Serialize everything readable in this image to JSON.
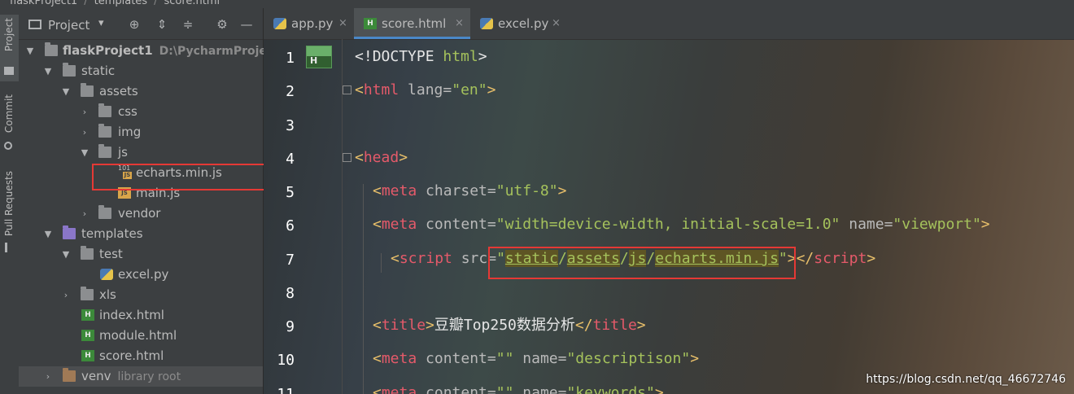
{
  "breadcrumb": {
    "items": [
      "flaskProject1",
      "templates",
      "score.html"
    ]
  },
  "tool_strip": {
    "tabs": [
      "Project",
      "Commit",
      "Pull Requests"
    ]
  },
  "project_panel": {
    "title": "Project",
    "dropdown_icon": "caret-down-icon",
    "header_icons": [
      "locate-icon",
      "expand-all-icon",
      "collapse-all-icon",
      "gear-icon",
      "minimize-icon"
    ],
    "tree": [
      {
        "label": "flaskProject1",
        "hint": "D:\\PycharmProjects",
        "icon": "folder-icon",
        "expanded": true,
        "bold": true
      },
      {
        "label": "static",
        "icon": "folder-icon",
        "expanded": true
      },
      {
        "label": "assets",
        "icon": "folder-icon",
        "expanded": true
      },
      {
        "label": "css",
        "icon": "folder-icon",
        "expanded": false
      },
      {
        "label": "img",
        "icon": "folder-icon",
        "expanded": false
      },
      {
        "label": "js",
        "icon": "folder-icon",
        "expanded": true
      },
      {
        "label": "echarts.min.js",
        "icon": "minified-js-file-icon"
      },
      {
        "label": "main.js",
        "icon": "js-file-icon"
      },
      {
        "label": "vendor",
        "icon": "folder-icon",
        "expanded": false
      },
      {
        "label": "templates",
        "icon": "templates-folder-icon",
        "expanded": true
      },
      {
        "label": "test",
        "icon": "folder-icon",
        "expanded": true
      },
      {
        "label": "excel.py",
        "icon": "python-file-icon"
      },
      {
        "label": "xls",
        "icon": "folder-icon",
        "expanded": false
      },
      {
        "label": "index.html",
        "icon": "html-file-icon"
      },
      {
        "label": "module.html",
        "icon": "html-file-icon"
      },
      {
        "label": "score.html",
        "icon": "html-file-icon"
      },
      {
        "label": "venv",
        "hint": "library root",
        "icon": "excluded-folder-icon",
        "expanded": false
      }
    ]
  },
  "editor": {
    "tabs": [
      {
        "label": "app.py",
        "icon": "python-file-icon",
        "close": "×"
      },
      {
        "label": "score.html",
        "icon": "html-file-icon",
        "close": "×",
        "active": true
      },
      {
        "label": "excel.py",
        "icon": "python-file-icon",
        "close": "×"
      }
    ],
    "file_badge_letter": "H",
    "line_numbers": [
      "1",
      "2",
      "3",
      "4",
      "5",
      "6",
      "7",
      "8",
      "9",
      "10",
      "11"
    ],
    "lines": {
      "l1": {
        "open": "<!",
        "name": "DOCTYPE",
        "rest": " html",
        "close": ">"
      },
      "l2": {
        "open": "<",
        "name": "html",
        "attr": " lang=",
        "val": "\"en\"",
        "close": ">"
      },
      "l4": {
        "open": "<",
        "name": "head",
        "close": ">"
      },
      "l5": {
        "open": "<",
        "name": "meta",
        "attr": " charset=",
        "val": "\"utf-8\"",
        "close": ">"
      },
      "l6": {
        "open": "<",
        "name": "meta",
        "attr1": " content=",
        "val1": "\"width=device-width, initial-scale=1.0\"",
        "attr2": " name=",
        "val2": "\"viewport\"",
        "close": ">"
      },
      "l7": {
        "open": "<",
        "name": "script",
        "attr": " src=",
        "q1": "\"",
        "p1": "static",
        "s1": "/",
        "p2": "assets",
        "s2": "/",
        "p3": "js",
        "s3": "/",
        "p4": "echarts.min.js",
        "q2": "\"",
        "close": ">",
        "end_open": "</",
        "end_name": "script",
        "end_close": ">"
      },
      "l9": {
        "open": "<",
        "name": "title",
        "close": ">",
        "text": "豆瓣Top250数据分析",
        "end_open": "</",
        "end_name": "title",
        "end_close": ">"
      },
      "l10": {
        "open": "<",
        "name": "meta",
        "attr1": " content=",
        "val1": "\"\"",
        "attr2": " name=",
        "val2": "\"descriptison\"",
        "close": ">"
      },
      "l11": {
        "open": "<",
        "name": "meta",
        "attr1": " content=",
        "val1": "\"\"",
        "attr2": " name=",
        "val2": "\"keywords\"",
        "close": ">"
      }
    }
  },
  "watermark": "https://blog.csdn.net/qq_46672746",
  "colors": {
    "highlight_box": "#e53935",
    "tab_accent": "#4a88c7",
    "tag_name": "#cc7832",
    "attr_value": "#a5c25c"
  }
}
